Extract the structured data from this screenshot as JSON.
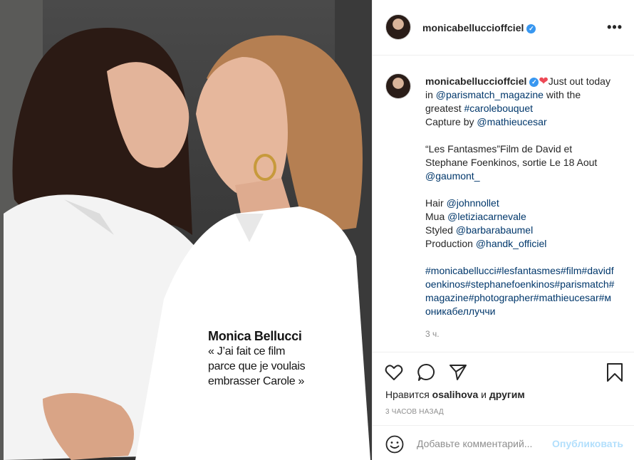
{
  "post": {
    "image": {
      "caption_name": "Monica Bellucci",
      "caption_quote": "« J’ai fait ce film\nparce que je voulais\nembrasser Carole »"
    }
  },
  "header": {
    "username": "monicabelluccioffciel",
    "verified_icon": "verified-badge-icon",
    "more_icon": "more-options-icon"
  },
  "comment": {
    "username": "monicabelluccioffciel",
    "line1": "Just out today in",
    "mention_parismatch": "@parismatch_magazine",
    "with": "with the greatest",
    "tag_carole": "#carolebouquet",
    "capture_by": "Capture by",
    "mention_mathieu": "@mathieucesar",
    "film_text": "“Les Fantasmes”Film de David et Stephane Foenkinos, sortie Le 18 Aout",
    "mention_gaumont": "@gaumont_",
    "hair_label": "Hair",
    "mention_hair": "@johnnollet",
    "mua_label": "Mua",
    "mention_mua": "@letiziacarnevale",
    "styled_label": "Styled",
    "mention_styled": "@barbarabaumel",
    "production_label": "Production",
    "mention_production": "@handk_officiel",
    "hashtags": "#monicabellucci#lesfantasmes#film#davidfoenkinos#stephanefoenkinos#parismatch#magazine#photographer#mathieucesar#моникабеллуччи",
    "age": "3 ч."
  },
  "actions": {
    "like_icon": "heart-outline-icon",
    "comment_icon": "comment-bubble-icon",
    "share_icon": "paper-plane-icon",
    "save_icon": "bookmark-icon",
    "likes_prefix": "Нравится",
    "likes_user": "osalihova",
    "likes_and": "и",
    "likes_others": "другим",
    "timestamp": "3 ЧАСОВ НАЗАД"
  },
  "add_comment": {
    "emoji_icon": "emoji-smile-icon",
    "placeholder": "Добавьте комментарий...",
    "publish_label": "Опубликовать"
  },
  "colors": {
    "link": "#00376b",
    "verified": "#3897f0",
    "heart": "#ed4956",
    "publish_disabled": "#b2dffc",
    "muted": "#8e8e8e"
  }
}
